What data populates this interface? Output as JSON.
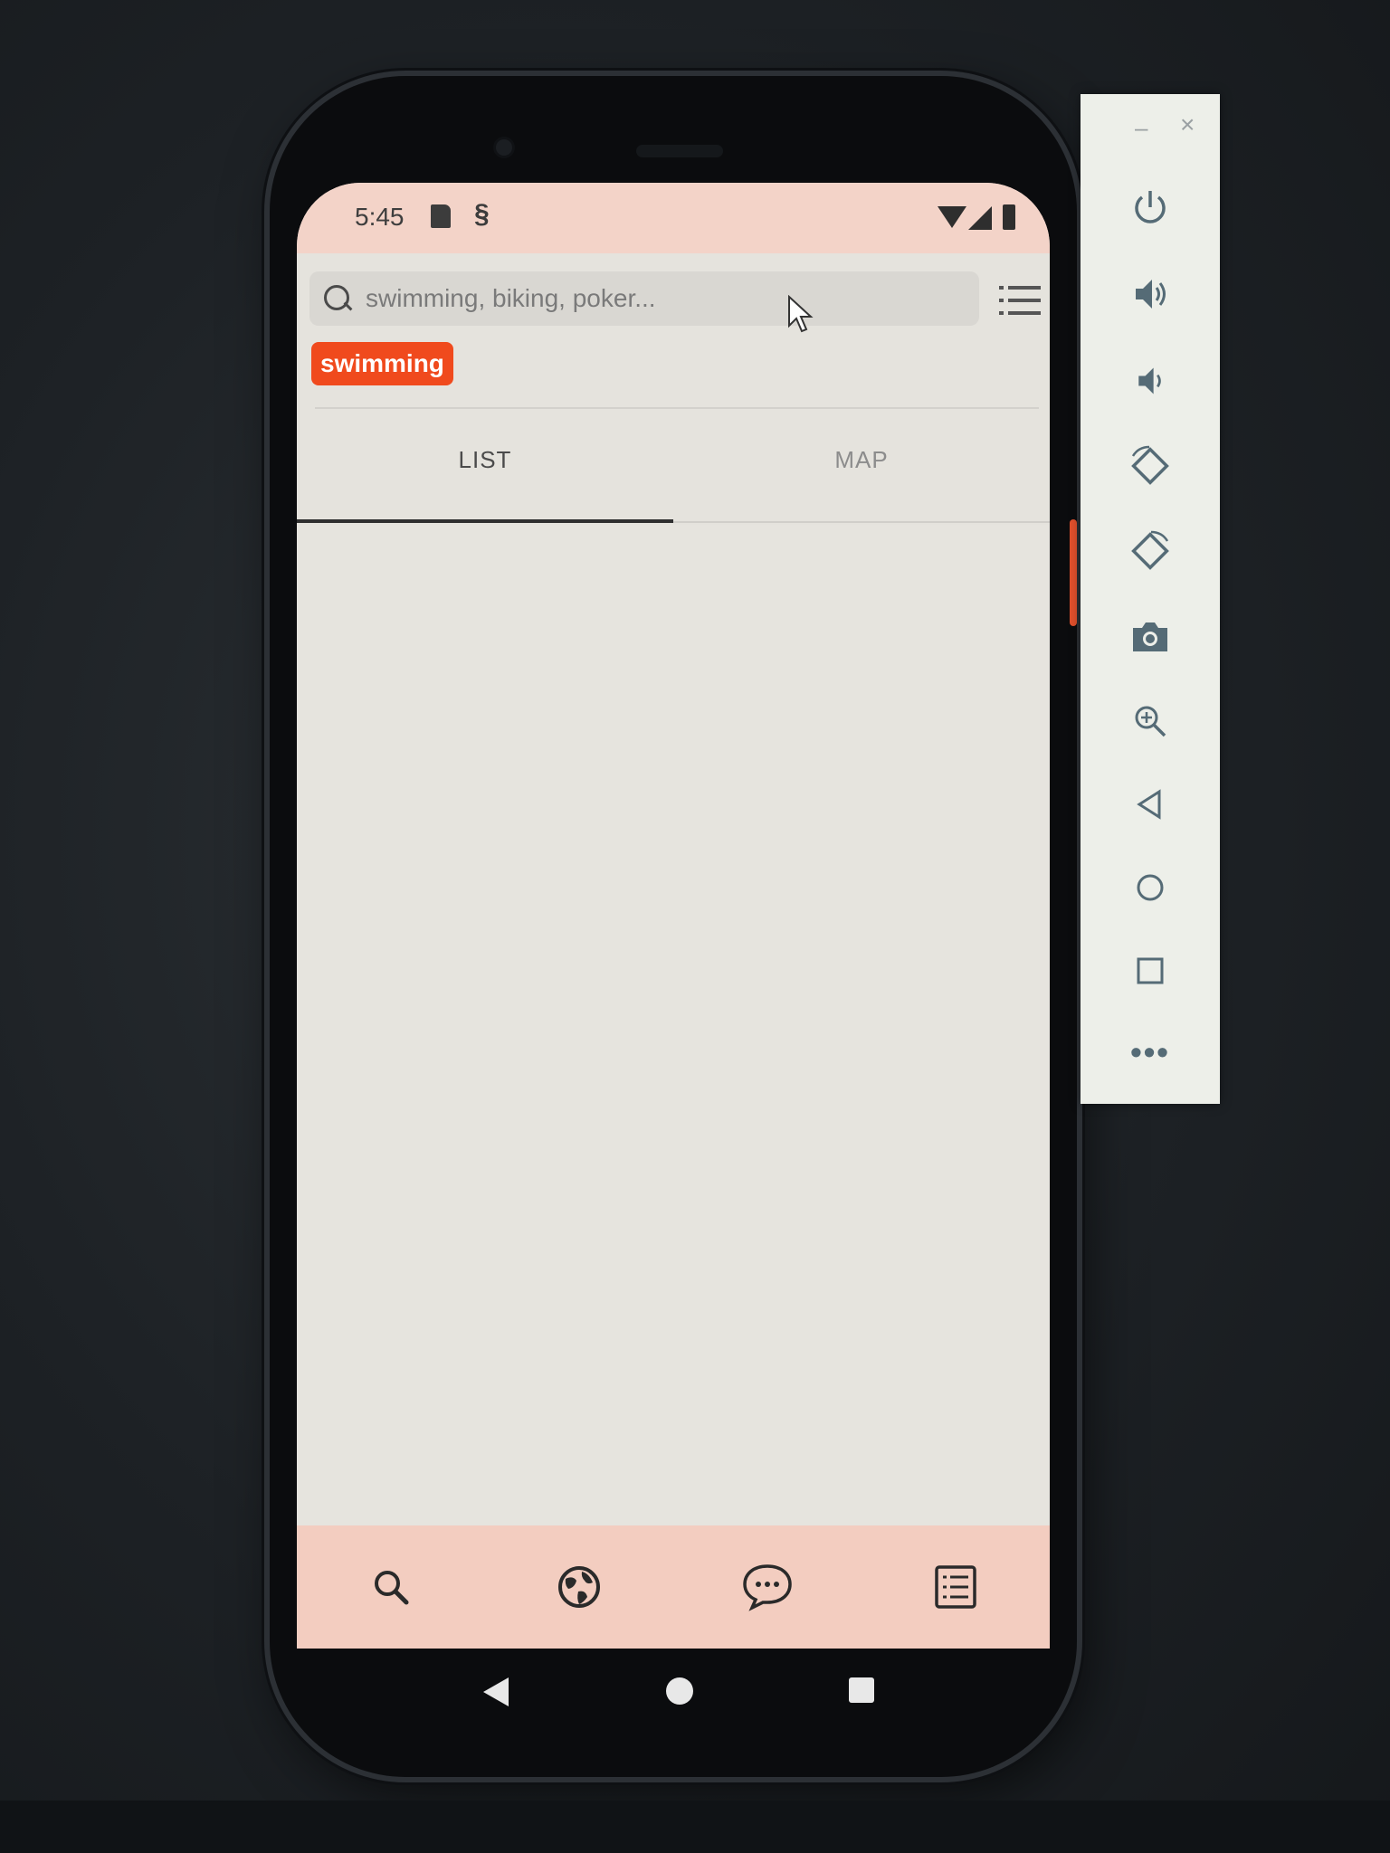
{
  "status_bar": {
    "time": "5:45",
    "icons": [
      "sd-card-icon",
      "sync-icon",
      "wifi-icon",
      "signal-icon",
      "battery-icon"
    ]
  },
  "search": {
    "placeholder": "swimming, biking, poker...",
    "value": "",
    "icon": "search-icon",
    "menu_icon": "list-filter-icon"
  },
  "filter_chips": [
    {
      "label": "swimming",
      "selected": true
    }
  ],
  "tabs": [
    {
      "label": "LIST",
      "active": true
    },
    {
      "label": "MAP",
      "active": false
    }
  ],
  "bottom_nav": [
    {
      "icon": "search-icon"
    },
    {
      "icon": "globe-icon"
    },
    {
      "icon": "chat-icon"
    },
    {
      "icon": "list-document-icon"
    }
  ],
  "system_nav": [
    "back-icon",
    "home-icon",
    "recents-icon"
  ],
  "emulator_panel": {
    "window_controls": {
      "minimize": "–",
      "close": "×"
    },
    "buttons": [
      "power-icon",
      "volume-up-icon",
      "volume-down-icon",
      "rotate-left-icon",
      "rotate-right-icon",
      "camera-icon",
      "zoom-icon",
      "back-icon",
      "home-icon",
      "overview-icon",
      "more-icon"
    ],
    "more_label": "•••"
  },
  "colors": {
    "accent": "#f04a1d",
    "status_bar_bg": "#f3d3c8",
    "nav_bar_bg": "#f3cdc0",
    "panel_icon": "#556b76"
  }
}
